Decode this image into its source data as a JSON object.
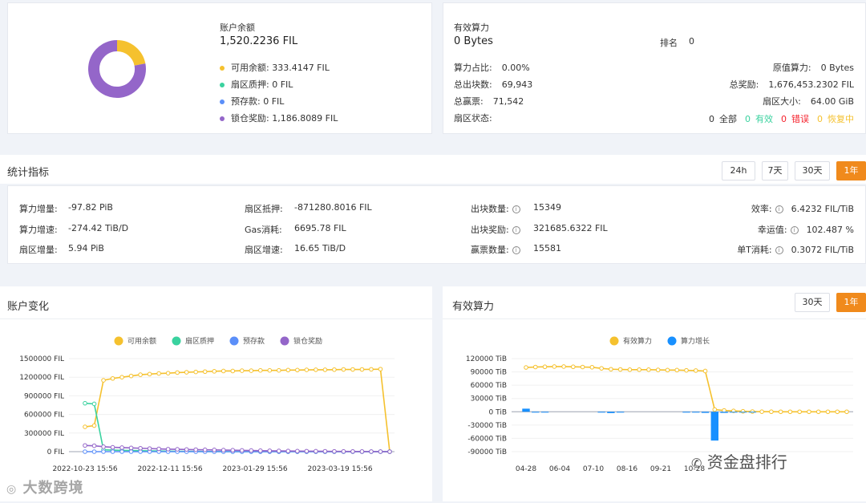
{
  "balance": {
    "title": "账户余额",
    "total": "1,520.2236 FIL",
    "items": [
      {
        "label": "可用余额: 333.4147 FIL",
        "color": "#f5c12e"
      },
      {
        "label": "扇区质押: 0 FIL",
        "color": "#3ad29f"
      },
      {
        "label": "预存款: 0 FIL",
        "color": "#5b8ff9"
      },
      {
        "label": "锁仓奖励: 1,186.8089 FIL",
        "color": "#9466c9"
      }
    ],
    "donut": [
      {
        "value": 333.4147,
        "color": "#f5c12e"
      },
      {
        "value": 1186.8089,
        "color": "#9466c9"
      }
    ]
  },
  "power": {
    "title": "有效算力",
    "value": "0 Bytes",
    "rank_label": "排名",
    "rank_value": "0",
    "left": [
      {
        "label": "算力占比:",
        "value": "0.00%"
      },
      {
        "label": "总出块数:",
        "value": "69,943"
      },
      {
        "label": "总赢票:",
        "value": "71,542"
      },
      {
        "label": "扇区状态:",
        "value": ""
      }
    ],
    "right": [
      {
        "label": "原值算力:",
        "value": "0 Bytes"
      },
      {
        "label": "总奖励:",
        "value": "1,676,453.2302 FIL"
      },
      {
        "label": "扇区大小:",
        "value": "64.00 GiB"
      }
    ],
    "sector_status": [
      {
        "count": "0",
        "label": "全部",
        "color": "#333333"
      },
      {
        "count": "0",
        "label": "有效",
        "color": "#3ad29f"
      },
      {
        "count": "0",
        "label": "错误",
        "color": "#f5222d"
      },
      {
        "count": "0",
        "label": "恢复中",
        "color": "#f5c12e"
      }
    ]
  },
  "stats": {
    "title": "统计指标",
    "ranges": [
      "24h",
      "7天",
      "30天",
      "1年"
    ],
    "active_range": "1年",
    "col1": [
      {
        "label": "算力增量:",
        "value": "-97.82 PiB"
      },
      {
        "label": "算力增速:",
        "value": "-274.42 TiB/D"
      },
      {
        "label": "扇区增量:",
        "value": "5.94 PiB"
      }
    ],
    "col2": [
      {
        "label": "扇区抵押:",
        "value": "-871280.8016 FIL"
      },
      {
        "label": "Gas消耗:",
        "value": "6695.78 FIL"
      },
      {
        "label": "扇区增速:",
        "value": "16.65 TiB/D"
      }
    ],
    "col3": [
      {
        "label": "出块数量:",
        "value": "15349"
      },
      {
        "label": "出块奖励:",
        "value": "321685.6322 FIL"
      },
      {
        "label": "赢票数量:",
        "value": "15581"
      }
    ],
    "col4": [
      {
        "label": "效率:",
        "value": "6.4232 FIL/TiB"
      },
      {
        "label": "幸运值:",
        "value": "102.487 %"
      },
      {
        "label": "单T消耗:",
        "value": "0.3072 FIL/TiB"
      }
    ]
  },
  "account_chart": {
    "title": "账户变化",
    "chart_data": {
      "type": "line",
      "series": [
        {
          "name": "可用余额",
          "color": "#f5c12e",
          "values": [
            400000,
            420000,
            1150000,
            1180000,
            1200000,
            1220000,
            1240000,
            1250000,
            1260000,
            1265000,
            1275000,
            1280000,
            1285000,
            1290000,
            1295000,
            1300000,
            1300000,
            1305000,
            1305000,
            1310000,
            1310000,
            1310000,
            1315000,
            1315000,
            1318000,
            1320000,
            1320000,
            1322000,
            1325000,
            1325000,
            1325000,
            1327000,
            1330000,
            0
          ]
        },
        {
          "name": "扇区质押",
          "color": "#3ad29f",
          "values": [
            780000,
            770000,
            30000,
            25000,
            20000,
            18000,
            15000,
            12000,
            10000,
            8000,
            6000,
            5000,
            4000,
            3000,
            2000,
            1000,
            0,
            0,
            0,
            0,
            0,
            0,
            0,
            0,
            0,
            0,
            0,
            0,
            0,
            0,
            0,
            0,
            0,
            0
          ]
        },
        {
          "name": "预存款",
          "color": "#5b8ff9",
          "values": [
            0,
            0,
            0,
            0,
            0,
            0,
            0,
            0,
            0,
            0,
            0,
            0,
            0,
            0,
            0,
            0,
            0,
            0,
            0,
            0,
            0,
            0,
            0,
            0,
            0,
            0,
            0,
            0,
            0,
            0,
            0,
            0,
            0,
            0
          ]
        },
        {
          "name": "锁仓奖励",
          "color": "#9466c9",
          "values": [
            100000,
            95000,
            80000,
            70000,
            65000,
            60000,
            55000,
            50000,
            45000,
            40000,
            38000,
            35000,
            32000,
            30000,
            28000,
            25000,
            23000,
            20000,
            18000,
            16000,
            14000,
            12000,
            10000,
            9000,
            8000,
            7000,
            6000,
            5000,
            4000,
            3000,
            2000,
            1500,
            1000,
            0
          ]
        }
      ],
      "y_ticks": [
        "1500000 FIL",
        "1200000 FIL",
        "900000 FIL",
        "600000 FIL",
        "300000 FIL",
        "0 FIL"
      ],
      "ylim": [
        0,
        1500000
      ],
      "x_ticks": [
        "2022-10-23 15:56",
        "2022-12-11 15:56",
        "2023-01-29 15:56",
        "2023-03-19 15:56"
      ],
      "legend": "top-center"
    }
  },
  "power_chart": {
    "title": "有效算力",
    "ranges": [
      "30天",
      "1年"
    ],
    "active_range": "1年",
    "chart_data": {
      "type": "line+bar",
      "series": [
        {
          "name": "有效算力",
          "color": "#f5c12e",
          "kind": "line",
          "values": [
            100000,
            101000,
            101500,
            102000,
            102000,
            101500,
            101000,
            100500,
            98000,
            96000,
            95500,
            95000,
            95000,
            95000,
            94500,
            94000,
            94000,
            93500,
            93000,
            92000,
            5000,
            3000,
            2000,
            1000,
            500,
            200,
            100,
            0,
            0,
            0,
            0,
            0,
            0,
            0,
            0
          ]
        },
        {
          "name": "算力增长",
          "color": "#1890ff",
          "kind": "bar",
          "values": [
            7000,
            -800,
            -500,
            0,
            0,
            0,
            0,
            0,
            -1000,
            -3000,
            -1200,
            0,
            0,
            0,
            0,
            0,
            0,
            -800,
            -1500,
            -2500,
            -65000,
            -2500,
            -1500,
            -800,
            -500,
            0,
            0,
            0,
            0,
            0,
            0,
            0,
            0,
            0,
            0
          ]
        }
      ],
      "y_ticks": [
        "120000 TiB",
        "90000 TiB",
        "60000 TiB",
        "30000 TiB",
        "0 TiB",
        "-30000 TiB",
        "-60000 TiB",
        "-90000 TiB"
      ],
      "ylim": [
        -90000,
        120000
      ],
      "x_ticks": [
        "04-28",
        "06-04",
        "07-10",
        "08-16",
        "09-21",
        "10-28"
      ],
      "legend": "top-center"
    }
  },
  "watermark_left": "大数跨境",
  "watermark_right": "资金盘排行"
}
